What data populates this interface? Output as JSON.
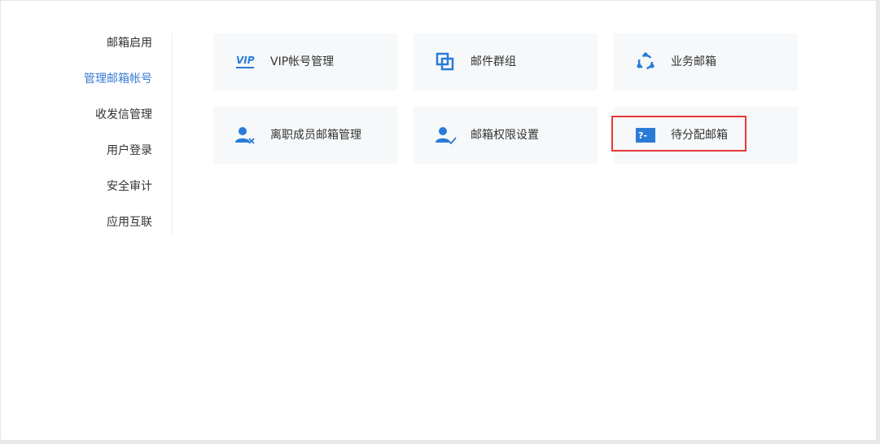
{
  "sidebar": {
    "items": [
      {
        "label": "邮箱启用",
        "active": false
      },
      {
        "label": "管理邮箱帐号",
        "active": true
      },
      {
        "label": "收发信管理",
        "active": false
      },
      {
        "label": "用户登录",
        "active": false
      },
      {
        "label": "安全审计",
        "active": false
      },
      {
        "label": "应用互联",
        "active": false
      }
    ]
  },
  "cards": [
    {
      "label": "VIP帐号管理",
      "icon": "vip-icon",
      "icon_text": "VIP"
    },
    {
      "label": "邮件群组",
      "icon": "mail-group-icon"
    },
    {
      "label": "业务邮箱",
      "icon": "business-mailbox-icon"
    },
    {
      "label": "离职成员邮箱管理",
      "icon": "departed-member-icon"
    },
    {
      "label": "邮箱权限设置",
      "icon": "mailbox-permission-icon"
    },
    {
      "label": "待分配邮箱",
      "icon": "pending-mailbox-icon",
      "icon_text": "?-",
      "highlighted": true
    }
  ],
  "colors": {
    "accent": "#2a7bd8",
    "active_text": "#3a7bd5",
    "highlight_border": "#e53935",
    "card_bg": "#f6f8fa"
  }
}
